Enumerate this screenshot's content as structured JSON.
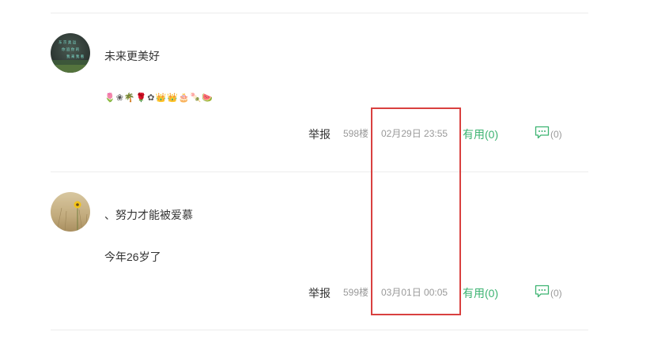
{
  "comments": [
    {
      "username": "未来更美好",
      "content": "🌷❀🌴🌹✿👑👑🎂🍡🍉",
      "report_label": "举报",
      "floor": "598楼",
      "time": "02月29日 23:55",
      "useful_label": "有用(0)",
      "reply_count": "(0)",
      "avatar_text": [
        "东 京 奥 运",
        "你 追 你 的",
        "我 来 我 看"
      ]
    },
    {
      "username": "、努力才能被爱慕",
      "content": "今年26岁了",
      "report_label": "举报",
      "floor": "599楼",
      "time": "03月01日 00:05",
      "useful_label": "有用(0)",
      "reply_count": "(0)"
    }
  ],
  "colors": {
    "accent_green": "#3cb371",
    "highlight_red": "#d9403f",
    "muted_text": "#999999"
  },
  "icons": {
    "reply": "comment-bubble-icon"
  }
}
